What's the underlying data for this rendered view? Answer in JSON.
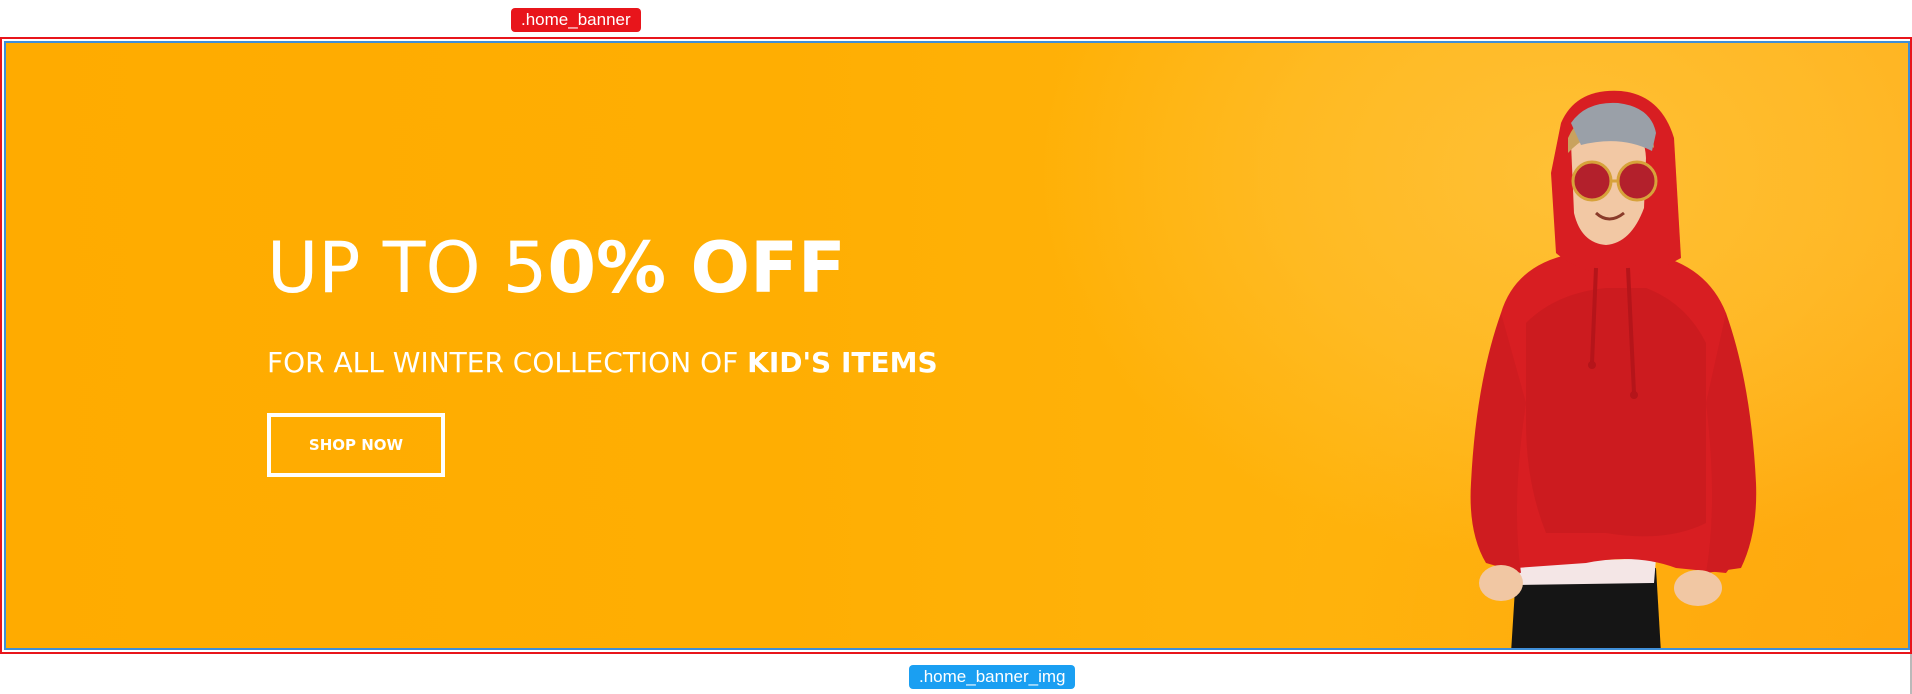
{
  "labels": {
    "home_banner": ".home_banner",
    "home_banner_img": ".home_banner_img"
  },
  "banner": {
    "headline_light": "UP TO 5",
    "headline_bold": "0% OFF",
    "subline_light": "FOR ALL WINTER COLLECTION OF ",
    "subline_bold": "KID'S ITEMS",
    "cta_label": "SHOP NOW"
  },
  "colors": {
    "banner_bg": "#ffab00",
    "label_red": "#e8151b",
    "label_blue": "#1a9ff2",
    "hoodie": "#d81e22"
  }
}
